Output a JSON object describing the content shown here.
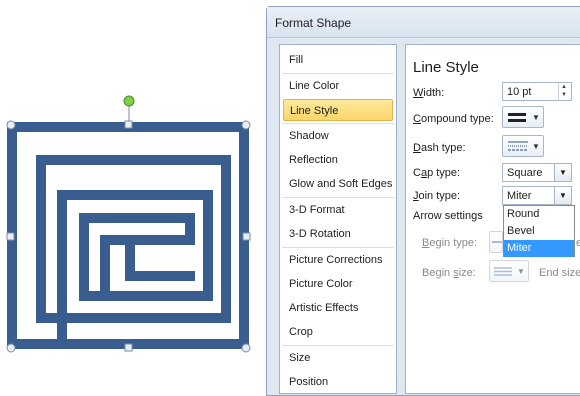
{
  "dialog": {
    "title": "Format Shape",
    "nav": [
      {
        "label": "Fill"
      },
      {
        "label": "Line Color"
      },
      {
        "label": "Line Style",
        "selected": true
      },
      {
        "label": "Shadow"
      },
      {
        "label": "Reflection"
      },
      {
        "label": "Glow and Soft Edges"
      },
      {
        "label": "3-D Format"
      },
      {
        "label": "3-D Rotation"
      },
      {
        "label": "Picture Corrections"
      },
      {
        "label": "Picture Color"
      },
      {
        "label": "Artistic Effects"
      },
      {
        "label": "Crop"
      },
      {
        "label": "Size"
      },
      {
        "label": "Position"
      }
    ],
    "line_style": {
      "section_title": "Line Style",
      "width_label_u": "W",
      "width_label_rest": "idth:",
      "width_value": "10 pt",
      "compound_label_u": "C",
      "compound_label_rest": "ompound type:",
      "dash_label_u": "D",
      "dash_label_rest": "ash type:",
      "cap_label_pre": "C",
      "cap_label_u": "a",
      "cap_label_rest": "p type:",
      "cap_value": "Square",
      "join_label_u": "J",
      "join_label_rest": "oin type:",
      "join_value": "Miter",
      "arrow_settings_label": "Arrow settings",
      "begin_type_label_u": "B",
      "begin_type_label_rest": "egin type:",
      "begin_size_label_pre": "Begin ",
      "begin_size_label_u": "s",
      "begin_size_label_rest": "ize:",
      "end_size_label": "End size:",
      "end_type_partial": "e"
    },
    "join_dropdown": {
      "options": [
        "Round",
        "Bevel",
        "Miter"
      ],
      "highlighted": "Miter"
    }
  },
  "colors": {
    "shape_fill": "#3a5d8f",
    "selection_border": "#7a8ea8",
    "rotate_handle": "#7ccf47",
    "selected_nav_bg": "#fbd66a",
    "dropdown_highlight": "#3399ff"
  }
}
